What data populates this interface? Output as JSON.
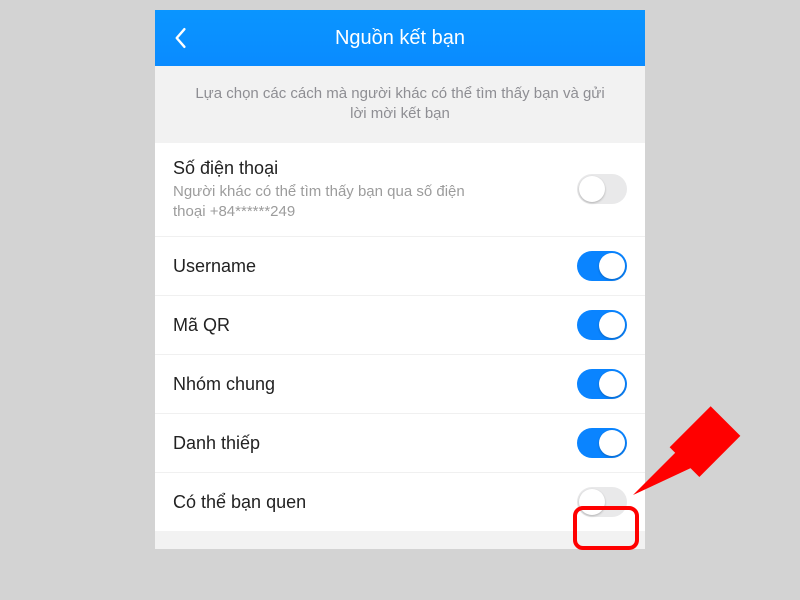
{
  "header": {
    "title": "Nguồn kết bạn"
  },
  "description": "Lựa chọn các cách mà người khác có thể tìm thấy bạn và gửi lời mời kết bạn",
  "rows": [
    {
      "label": "Số điện thoại",
      "sub": "Người khác có thể tìm thấy bạn qua số điện thoại +84******249",
      "on": false
    },
    {
      "label": "Username",
      "sub": "",
      "on": true
    },
    {
      "label": "Mã QR",
      "sub": "",
      "on": true
    },
    {
      "label": "Nhóm chung",
      "sub": "",
      "on": true
    },
    {
      "label": "Danh thiếp",
      "sub": "",
      "on": true
    },
    {
      "label": "Có thể bạn quen",
      "sub": "",
      "on": false
    }
  ],
  "colors": {
    "accent": "#0a84ff",
    "highlight": "#ff0000"
  }
}
